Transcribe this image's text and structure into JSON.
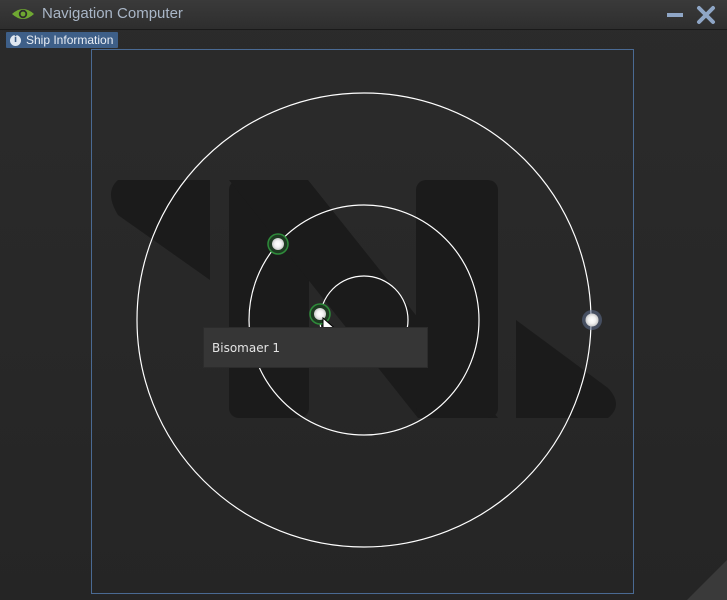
{
  "window": {
    "title": "Navigation Computer",
    "title_icon": "eye-icon",
    "minimize_icon": "minimize-icon",
    "close_icon": "close-icon"
  },
  "tabs": [
    {
      "label": "Ship Information",
      "icon": "info-icon",
      "icon_glyph": "i"
    }
  ],
  "map": {
    "watermark_icon": "NL-logo-watermark",
    "orbits": 3,
    "bodies": [
      {
        "name": "inner-body",
        "highlight": "#2e8b3a"
      },
      {
        "name": "middle-body",
        "highlight": "#2e8b3a"
      },
      {
        "name": "outer-body",
        "highlight": "#8aa2d6"
      }
    ],
    "tooltip": "Bisomaer 1"
  },
  "colors": {
    "accent": "#3e5f88",
    "title_text": "#a9b6c7",
    "panel_border": "#4a6a93",
    "orbit": "#ffffff",
    "selected_glow": "#2e8b3a"
  }
}
